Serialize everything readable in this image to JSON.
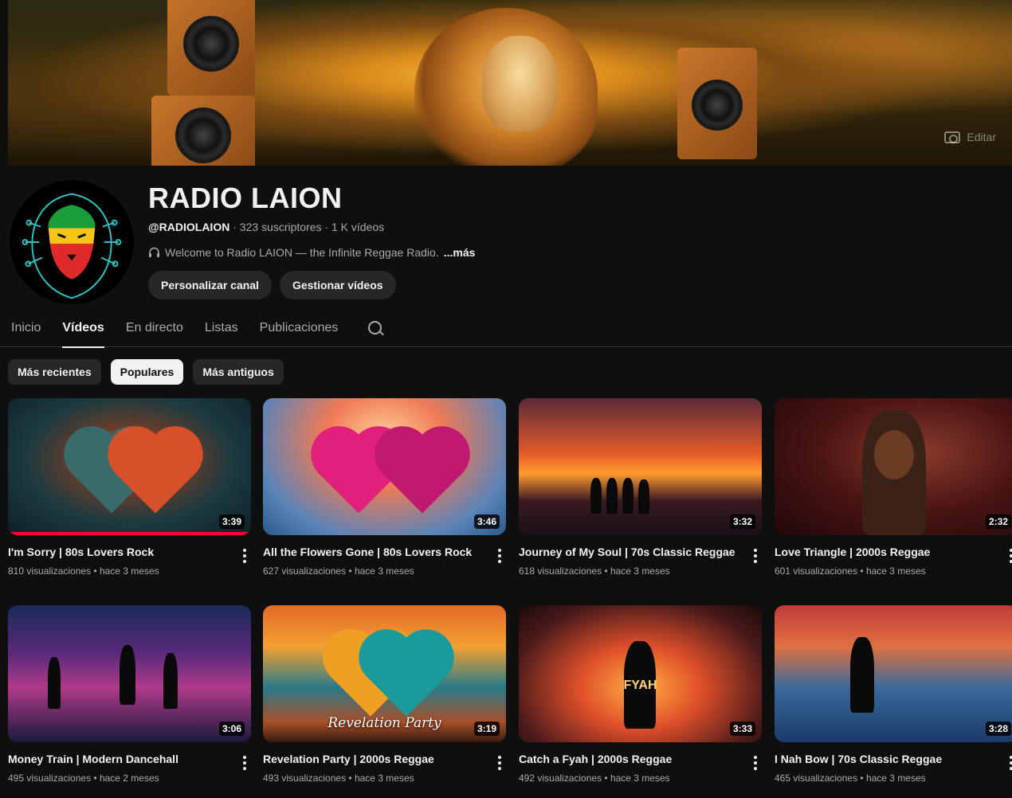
{
  "banner": {
    "edit_label": "Editar"
  },
  "channel": {
    "name": "RADIO LAION",
    "handle": "@RADIOLAION",
    "subscribers": "323 suscriptores",
    "video_count": "1 K vídeos",
    "separator": " · ",
    "description": "Welcome to Radio LAION — the Infinite Reggae Radio.",
    "more_label": "...más",
    "buttons": {
      "customize": "Personalizar canal",
      "manage": "Gestionar vídeos"
    }
  },
  "tabs": [
    {
      "label": "Inicio",
      "active": false
    },
    {
      "label": "Vídeos",
      "active": true
    },
    {
      "label": "En directo",
      "active": false
    },
    {
      "label": "Listas",
      "active": false
    },
    {
      "label": "Publicaciones",
      "active": false
    }
  ],
  "chips": [
    {
      "label": "Más recientes",
      "selected": false
    },
    {
      "label": "Populares",
      "selected": true
    },
    {
      "label": "Más antiguos",
      "selected": false
    }
  ],
  "videos": [
    {
      "title": "I'm Sorry | 80s Lovers Rock",
      "views": "810 visualizaciones",
      "age": "hace 3 meses",
      "duration": "3:39",
      "watched": 1.0
    },
    {
      "title": "All the Flowers Gone | 80s Lovers Rock",
      "views": "627 visualizaciones",
      "age": "hace 3 meses",
      "duration": "3:46"
    },
    {
      "title": "Journey of My Soul | 70s Classic Reggae",
      "views": "618 visualizaciones",
      "age": "hace 3 meses",
      "duration": "3:32"
    },
    {
      "title": "Love Triangle | 2000s Reggae",
      "views": "601 visualizaciones",
      "age": "hace 3 meses",
      "duration": "2:32"
    },
    {
      "title": "Money Train | Modern Dancehall",
      "views": "495 visualizaciones",
      "age": "hace 2 meses",
      "duration": "3:06"
    },
    {
      "title": "Revelation Party | 2000s Reggae",
      "views": "493 visualizaciones",
      "age": "hace 3 meses",
      "duration": "3:19",
      "thumb_text": "Revelation Party"
    },
    {
      "title": "Catch a Fyah | 2000s Reggae",
      "views": "492 visualizaciones",
      "age": "hace 3 meses",
      "duration": "3:33",
      "thumb_text": "FYAH"
    },
    {
      "title": "I Nah Bow | 70s Classic Reggae",
      "views": "465 visualizaciones",
      "age": "hace 3 meses",
      "duration": "3:28"
    }
  ],
  "stats_separator": " • ",
  "colors": {
    "background": "#0f0f0f",
    "chip": "#272727",
    "accent_red": "#ff0033",
    "text_secondary": "#aaaaaa"
  }
}
